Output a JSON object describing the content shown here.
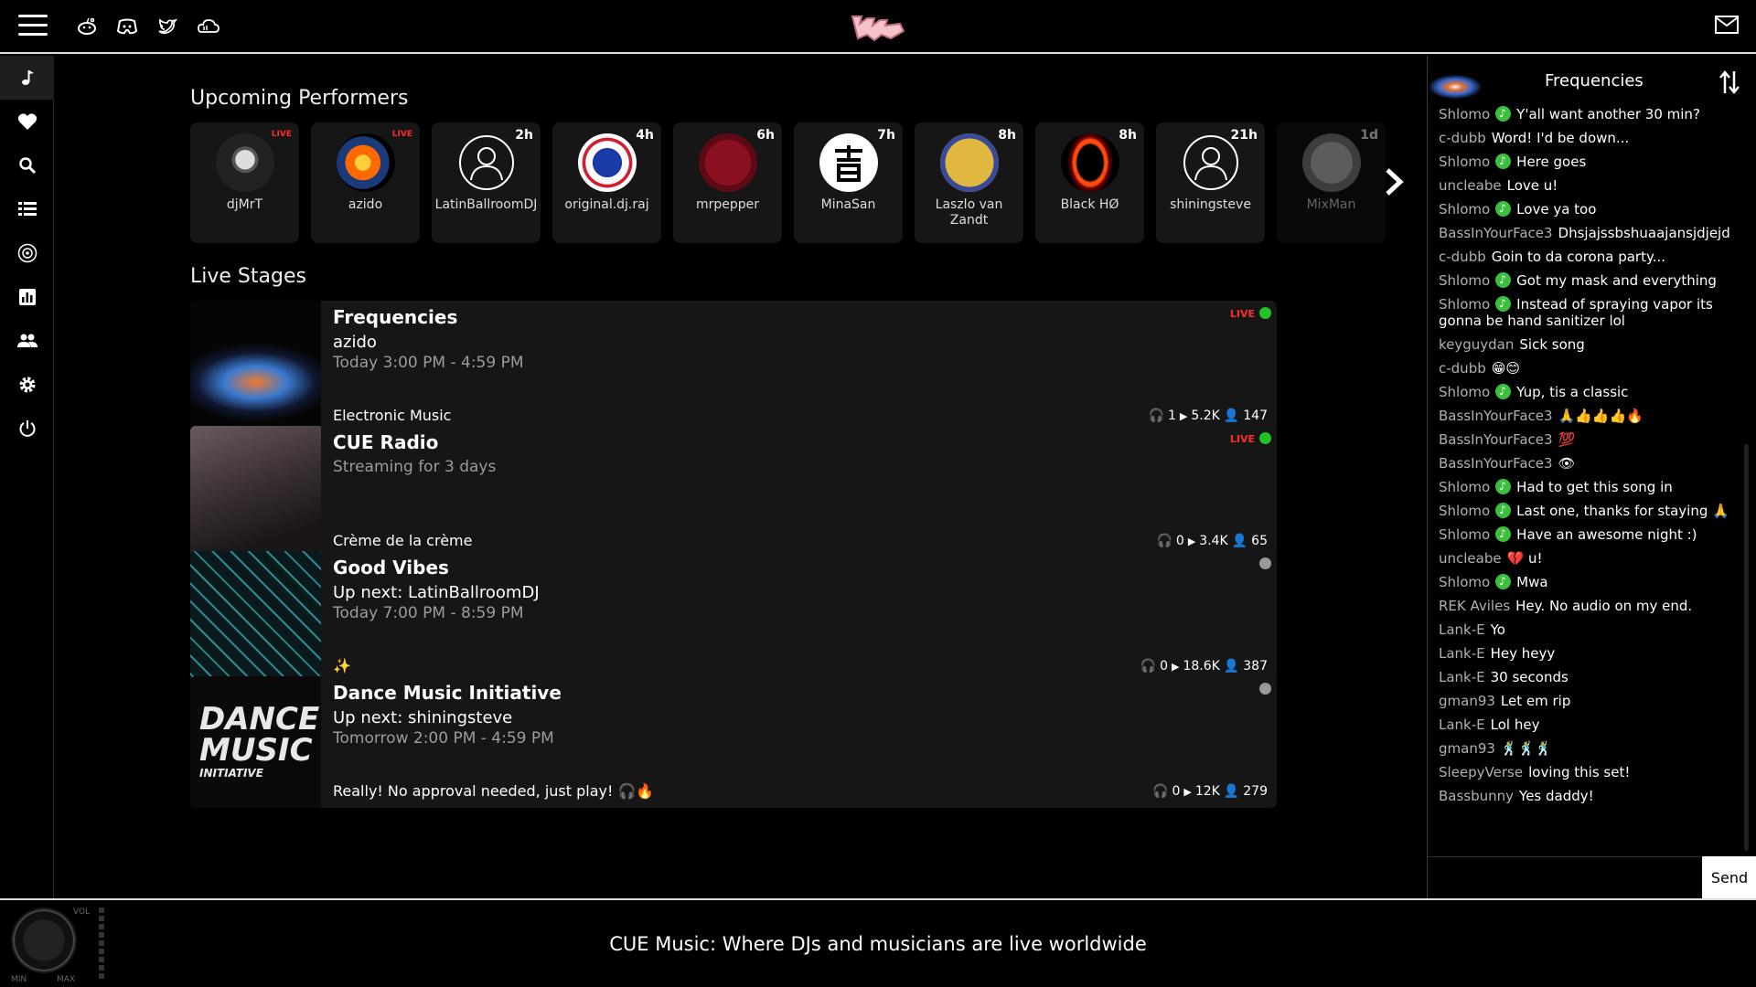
{
  "header": {
    "social_icons": [
      "reddit-icon",
      "discord-icon",
      "twitter-icon",
      "soundcloud-icon"
    ],
    "logo_text": "CUE"
  },
  "sidebar": {
    "items": [
      "music-note-icon",
      "heart-icon",
      "search-icon",
      "list-icon",
      "vinyl-icon",
      "chart-icon",
      "people-icon",
      "gear-icon",
      "power-icon"
    ]
  },
  "upcoming": {
    "title": "Upcoming Performers",
    "performers": [
      {
        "name": "djMrT",
        "tag": "LIVE"
      },
      {
        "name": "azido",
        "tag": "LIVE"
      },
      {
        "name": "LatinBallroomDJ",
        "tag": "2h"
      },
      {
        "name": "original.dj.raj",
        "tag": "4h"
      },
      {
        "name": "mrpepper",
        "tag": "6h"
      },
      {
        "name": "MinaSan",
        "tag": "7h"
      },
      {
        "name": "Laszlo van Zandt",
        "tag": "8h"
      },
      {
        "name": "Black HØ",
        "tag": "8h"
      },
      {
        "name": "shiningsteve",
        "tag": "21h"
      },
      {
        "name": "MixMan",
        "tag": "1d"
      }
    ]
  },
  "live_stages": {
    "title": "Live Stages",
    "stages": [
      {
        "title": "Frequencies",
        "subtitle": "azido",
        "time": "Today 3:00 PM - 4:59 PM",
        "description": "Electronic Music",
        "live": "LIVE",
        "listeners": "1",
        "plays": "5.2K",
        "followers": "147"
      },
      {
        "title": "CUE Radio",
        "subtitle": "",
        "time": "Streaming for 3 days",
        "description": "Crème de la crème",
        "live": "LIVE",
        "listeners": "0",
        "plays": "3.4K",
        "followers": "65"
      },
      {
        "title": "Good Vibes",
        "subtitle": "Up next: LatinBallroomDJ",
        "time": "Today 7:00 PM - 8:59 PM",
        "description": "✨",
        "live": "",
        "listeners": "0",
        "plays": "18.6K",
        "followers": "387"
      },
      {
        "title": "Dance Music Initiative",
        "subtitle": "Up next: shiningsteve",
        "time": "Tomorrow 2:00 PM - 4:59 PM",
        "description": "Really! No approval needed, just play! 🎧🔥",
        "live": "",
        "listeners": "0",
        "plays": "12K",
        "followers": "279"
      }
    ]
  },
  "chat": {
    "title": "Frequencies",
    "send_label": "Send",
    "messages": [
      {
        "user": "Shlomo",
        "badge": true,
        "text": "Y'all want another 30 min?"
      },
      {
        "user": "c-dubb",
        "badge": false,
        "text": "Word! I'd be down..."
      },
      {
        "user": "Shlomo",
        "badge": true,
        "text": "Here goes"
      },
      {
        "user": "uncleabe",
        "badge": false,
        "text": "Love u!"
      },
      {
        "user": "Shlomo",
        "badge": true,
        "text": "Love ya too"
      },
      {
        "user": "BassInYourFace3",
        "badge": false,
        "text": "Dhsjajssbshuaajansjdjejd"
      },
      {
        "user": "c-dubb",
        "badge": false,
        "text": "Goin to da corona party..."
      },
      {
        "user": "Shlomo",
        "badge": true,
        "text": "Got my mask and everything"
      },
      {
        "user": "Shlomo",
        "badge": true,
        "text": "Instead of spraying vapor its gonna be hand sanitizer lol"
      },
      {
        "user": "keyguydan",
        "badge": false,
        "text": "Sick song"
      },
      {
        "user": "c-dubb",
        "badge": false,
        "text": "😁😊"
      },
      {
        "user": "Shlomo",
        "badge": true,
        "text": "Yup, tis a classic"
      },
      {
        "user": "BassInYourFace3",
        "badge": false,
        "text": "🙏👍👍👍🔥"
      },
      {
        "user": "BassInYourFace3",
        "badge": false,
        "text": "💯"
      },
      {
        "user": "BassInYourFace3",
        "badge": false,
        "text": "👁"
      },
      {
        "user": "Shlomo",
        "badge": true,
        "text": "Had to get this song in"
      },
      {
        "user": "Shlomo",
        "badge": true,
        "text": "Last one, thanks for staying 🙏"
      },
      {
        "user": "Shlomo",
        "badge": true,
        "text": "Have an awesome night :)"
      },
      {
        "user": "uncleabe",
        "badge": false,
        "text": "💔 u!"
      },
      {
        "user": "Shlomo",
        "badge": true,
        "text": "Mwa"
      },
      {
        "user": "REK Aviles",
        "badge": false,
        "text": "Hey. No audio on my end."
      },
      {
        "user": "Lank-E",
        "badge": false,
        "text": "Yo"
      },
      {
        "user": "Lank-E",
        "badge": false,
        "text": "Hey heyy"
      },
      {
        "user": "Lank-E",
        "badge": false,
        "text": "30 seconds"
      },
      {
        "user": "gman93",
        "badge": false,
        "text": "Let em rip"
      },
      {
        "user": "Lank-E",
        "badge": false,
        "text": "Lol hey"
      },
      {
        "user": "gman93",
        "badge": false,
        "text": "🕺🕺🕺"
      },
      {
        "user": "SleepyVerse",
        "badge": false,
        "text": "loving this set!"
      },
      {
        "user": "Bassbunny",
        "badge": false,
        "text": "Yes daddy!"
      }
    ]
  },
  "footer": {
    "tagline": "CUE Music: Where DJs and musicians are live worldwide",
    "vol_label": "VOL",
    "min_label": "MIN",
    "max_label": "MAX"
  },
  "colors": {
    "live": "#ff2a2a",
    "live_dot": "#22c322",
    "offline_dot": "#9a9a9a",
    "badge": "#3cbf3c"
  }
}
